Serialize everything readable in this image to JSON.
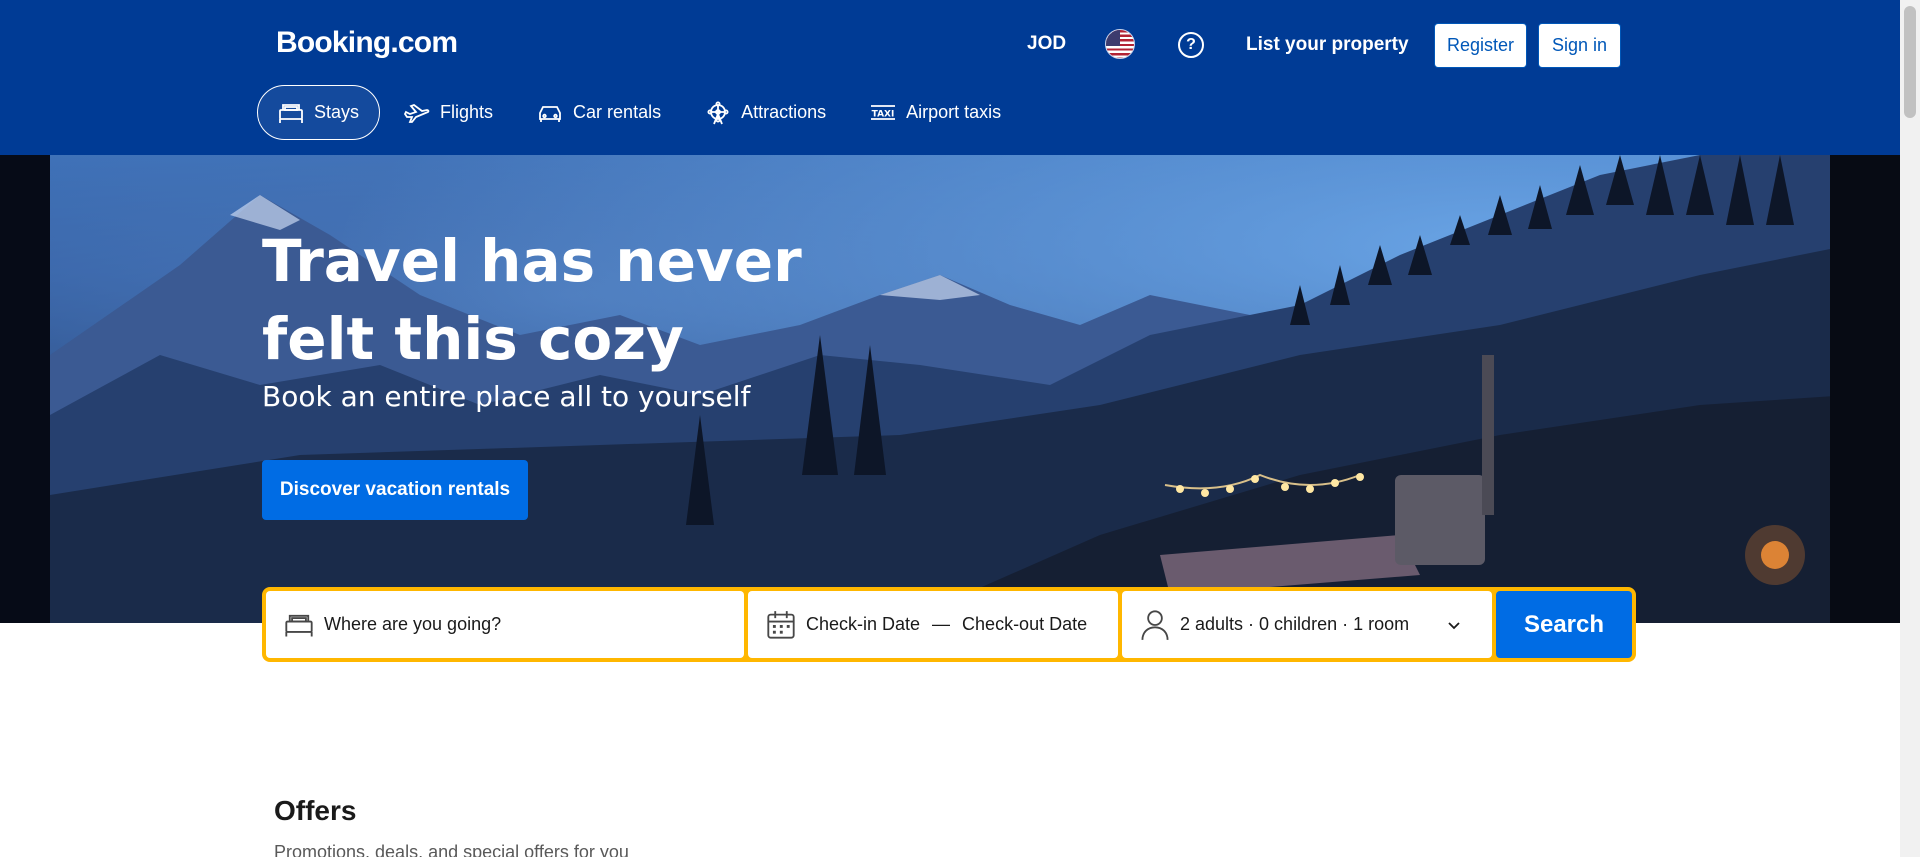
{
  "header": {
    "logo": "Booking.com",
    "currency": "JOD",
    "help_icon": "?",
    "list_property": "List your property",
    "register": "Register",
    "sign_in": "Sign in",
    "tabs": [
      {
        "label": "Stays",
        "icon": "bed-icon",
        "active": true
      },
      {
        "label": "Flights",
        "icon": "plane-icon",
        "active": false
      },
      {
        "label": "Car rentals",
        "icon": "car-icon",
        "active": false
      },
      {
        "label": "Attractions",
        "icon": "ferris-wheel-icon",
        "active": false
      },
      {
        "label": "Airport taxis",
        "icon": "taxi-icon",
        "active": false
      }
    ]
  },
  "hero": {
    "title_line1": "Travel has never",
    "title_line2": "felt this cozy",
    "subtitle": "Book an entire place all to yourself",
    "cta": "Discover vacation rentals"
  },
  "search": {
    "destination_placeholder": "Where are you going?",
    "checkin": "Check-in Date",
    "dash": "—",
    "checkout": "Check-out Date",
    "guests": "2 adults · 0 children · 1 room",
    "button": "Search"
  },
  "offers": {
    "title": "Offers",
    "subtitle": "Promotions, deals, and special offers for you"
  },
  "colors": {
    "brand_blue": "#003b95",
    "action_blue": "#006ce4",
    "search_border": "#ffb700"
  }
}
